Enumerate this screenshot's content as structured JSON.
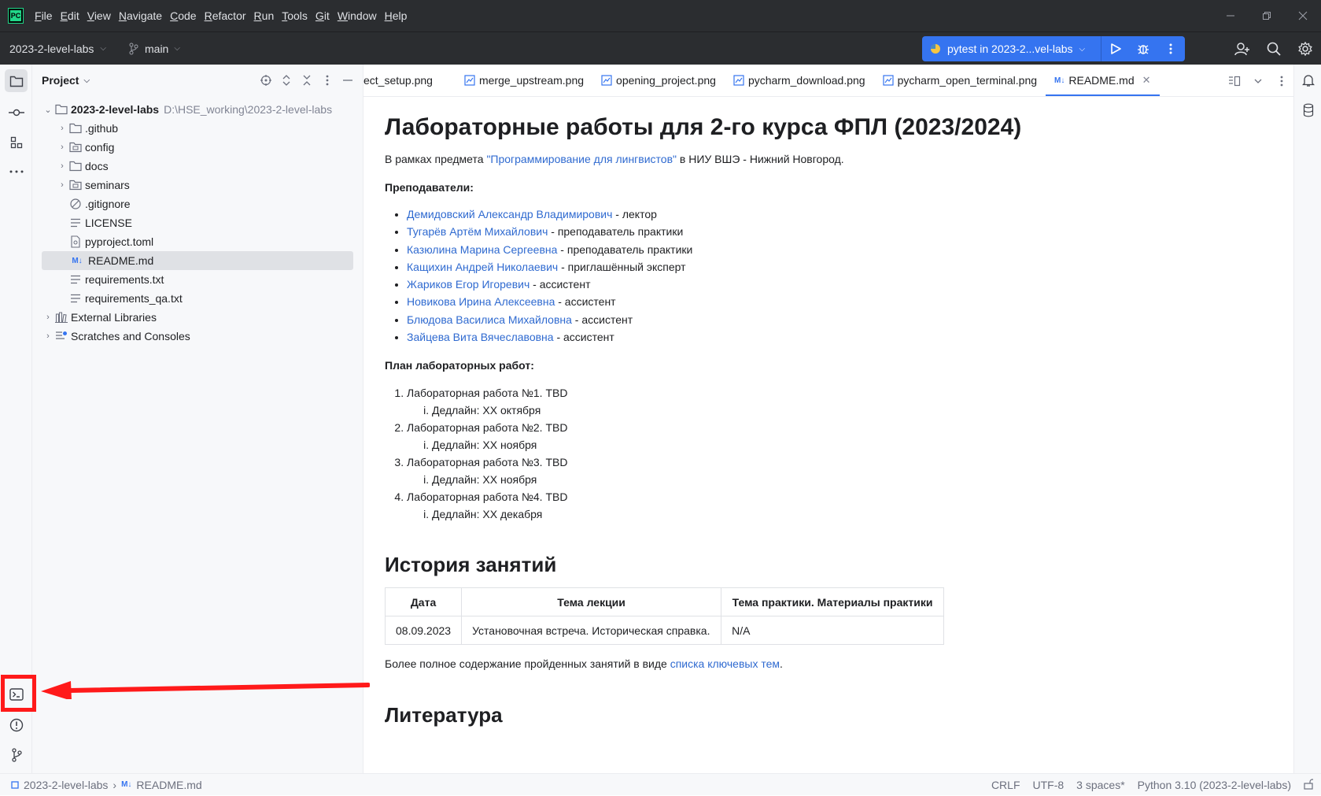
{
  "menubar": {
    "logo": "PC",
    "items": [
      {
        "mn": "F",
        "rest": "ile"
      },
      {
        "mn": "E",
        "rest": "dit"
      },
      {
        "mn": "V",
        "rest": "iew"
      },
      {
        "mn": "N",
        "rest": "avigate"
      },
      {
        "mn": "C",
        "rest": "ode"
      },
      {
        "mn": "R",
        "rest": "efactor"
      },
      {
        "mn": "R",
        "rest": "un"
      },
      {
        "mn": "T",
        "rest": "ools"
      },
      {
        "mn": "G",
        "rest": "it"
      },
      {
        "mn": "W",
        "rest": "indow"
      },
      {
        "mn": "H",
        "rest": "elp"
      }
    ]
  },
  "toolbar": {
    "project": "2023-2-level-labs",
    "branch": "main",
    "run_config": "pytest in 2023-2...vel-labs"
  },
  "project_panel": {
    "title": "Project",
    "root_name": "2023-2-level-labs",
    "root_path": "D:\\HSE_working\\2023-2-level-labs",
    "folders": [
      ".github",
      "config",
      "docs",
      "seminars"
    ],
    "files": [
      ".gitignore",
      "LICENSE",
      "pyproject.toml",
      "README.md",
      "requirements.txt",
      "requirements_qa.txt"
    ],
    "external_libraries": "External Libraries",
    "scratches": "Scratches and Consoles"
  },
  "tabs": [
    {
      "label": "ect_setup.png"
    },
    {
      "label": "merge_upstream.png"
    },
    {
      "label": "opening_project.png"
    },
    {
      "label": "pycharm_download.png"
    },
    {
      "label": "pycharm_open_terminal.png"
    },
    {
      "label": "README.md"
    }
  ],
  "md_badge": "M↓",
  "readme": {
    "title": "Лабораторные работы для 2-го курса ФПЛ (2023/2024)",
    "intro_before": "В рамках предмета ",
    "intro_link": "\"Программирование для лингвистов\"",
    "intro_after": " в НИУ ВШЭ - Нижний Новгород.",
    "teachers_heading": "Преподаватели:",
    "teachers": [
      {
        "name": "Демидовский Александр Владимирович",
        "role": " - лектор"
      },
      {
        "name": "Тугарёв Артём Михайлович",
        "role": " - преподаватель практики"
      },
      {
        "name": "Казюлина Марина Сергеевна",
        "role": " - преподаватель практики"
      },
      {
        "name": "Кащихин Андрей Николаевич",
        "role": " - приглашённый эксперт"
      },
      {
        "name": "Жариков Егор Игоревич",
        "role": " - ассистент"
      },
      {
        "name": "Новикова Ирина Алексеевна",
        "role": " - ассистент"
      },
      {
        "name": "Блюдова Василиса Михайловна",
        "role": " - ассистент"
      },
      {
        "name": "Зайцева Вита Вячеславовна",
        "role": " - ассистент"
      }
    ],
    "plan_heading": "План лабораторных работ:",
    "labs": [
      {
        "title": "Лабораторная работа №1. TBD",
        "deadline": "Дедлайн: XX октября"
      },
      {
        "title": "Лабораторная работа №2. TBD",
        "deadline": "Дедлайн: XX ноября"
      },
      {
        "title": "Лабораторная работа №3. TBD",
        "deadline": "Дедлайн: XX ноября"
      },
      {
        "title": "Лабораторная работа №4. TBD",
        "deadline": "Дедлайн: XX декабря"
      }
    ],
    "history_heading": "История занятий",
    "table": {
      "headers": [
        "Дата",
        "Тема лекции",
        "Тема практики. Материалы практики"
      ],
      "rows": [
        [
          "08.09.2023",
          "Установочная встреча. Историческая справка.",
          "N/A"
        ]
      ]
    },
    "more_before": "Более полное содержание пройденных занятий в виде ",
    "more_link": "списка ключевых тем",
    "more_after": ".",
    "literature_heading": "Литература"
  },
  "statusbar": {
    "crumb_project": "2023-2-level-labs",
    "crumb_file": "README.md",
    "line_sep": "CRLF",
    "encoding": "UTF-8",
    "indent": "3 spaces*",
    "interpreter": "Python 3.10 (2023-2-level-labs)"
  },
  "colors": {
    "accent": "#3574f0",
    "link": "#2f6ad0",
    "annotation": "#ff1a1a"
  }
}
